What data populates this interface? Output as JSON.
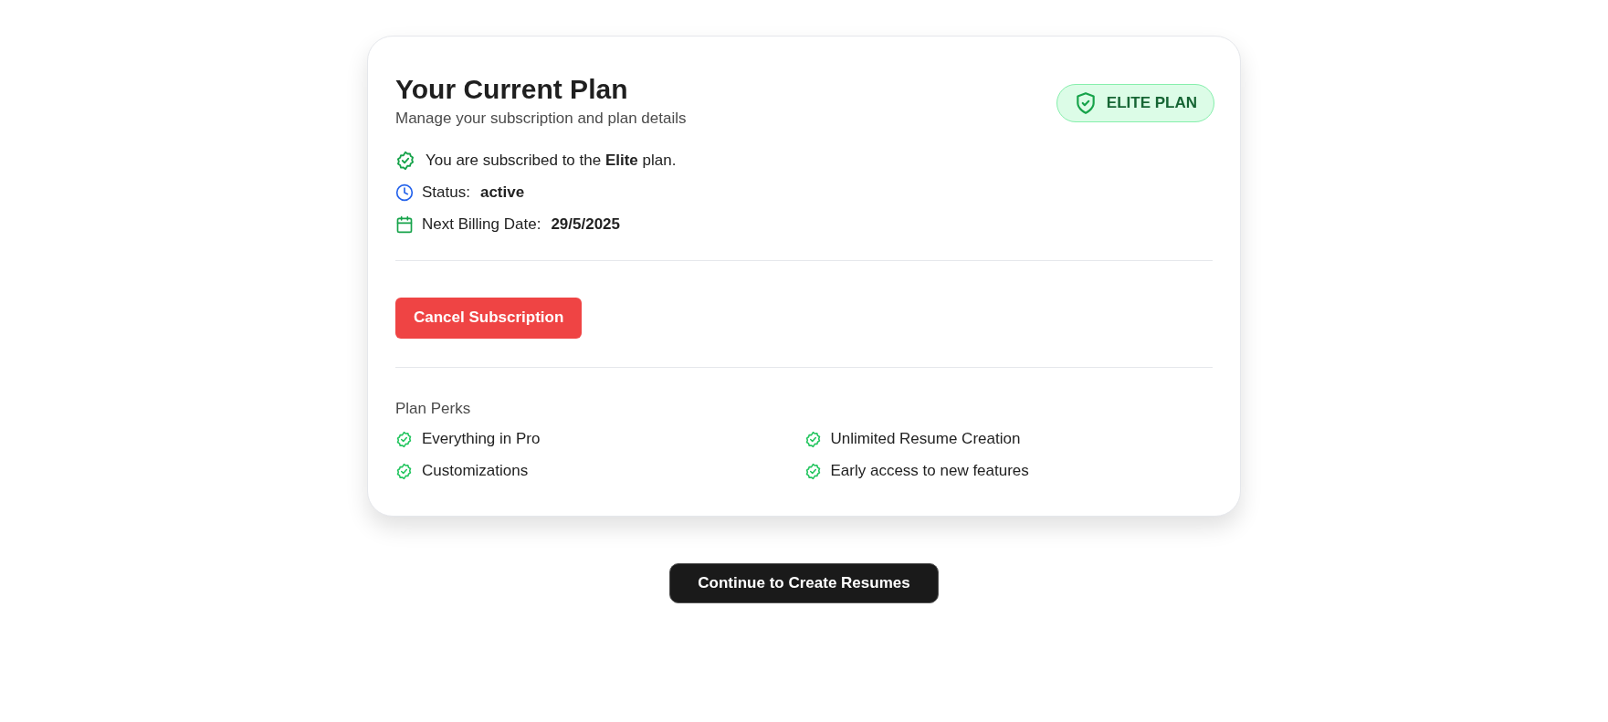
{
  "card": {
    "title": "Your Current Plan",
    "subtitle": "Manage your subscription and plan details",
    "badge": "ELITE PLAN",
    "details": [
      {
        "kind": "subscribed",
        "text": "You are subscribed to the **Elite** plan."
      },
      {
        "kind": "status",
        "label": "Status:",
        "value": "active"
      },
      {
        "kind": "billing",
        "label": "Next Billing Date:",
        "value": "29/5/2025"
      }
    ],
    "cancel_button": "Cancel Subscription",
    "perks_title": "Plan Perks",
    "perks": [
      "Everything in Pro",
      "Unlimited Resume Creation",
      "Customizations",
      "Early access to new features"
    ]
  },
  "continue_button": "Continue to Create Resumes"
}
